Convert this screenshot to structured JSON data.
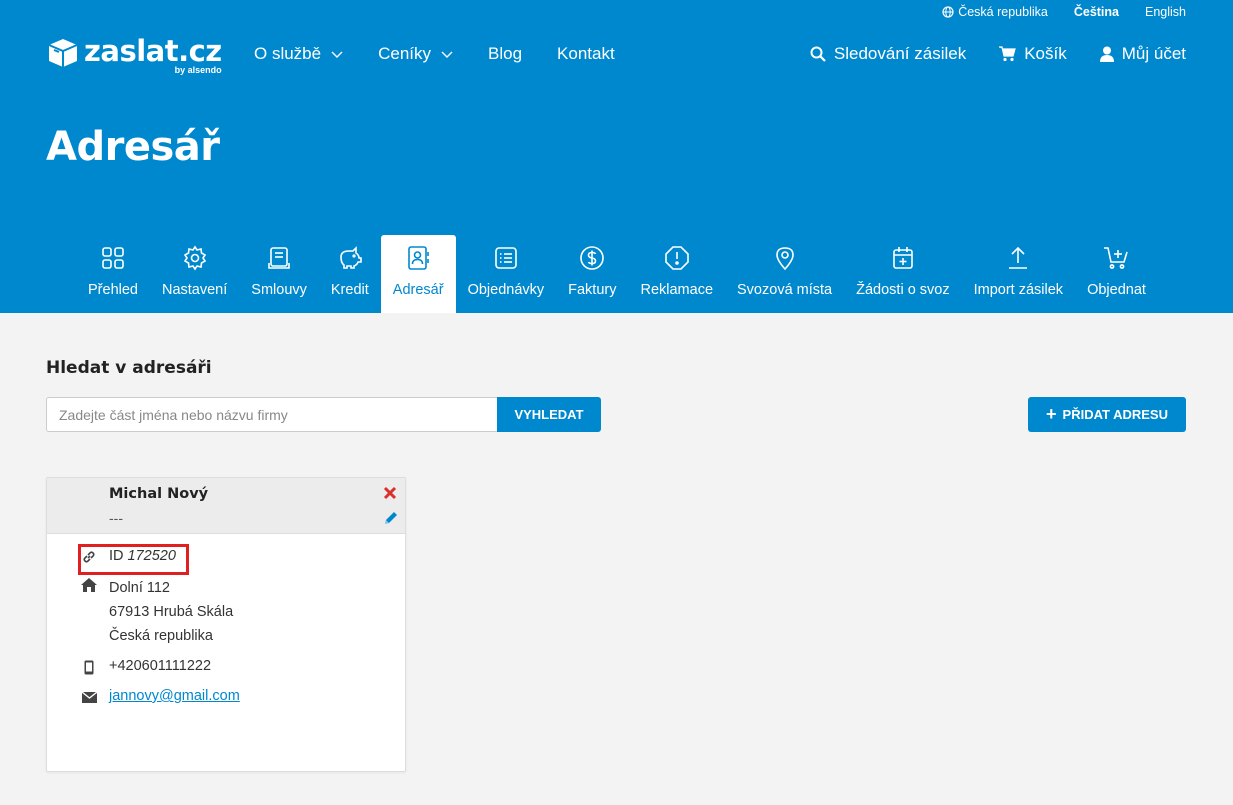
{
  "topbar": {
    "country": "Česká republika",
    "lang_active": "Čeština",
    "lang_other": "English"
  },
  "logo": {
    "name": "zaslat.cz",
    "by": "by alsendo"
  },
  "mainnav": {
    "about": "O službě",
    "prices": "Ceníky",
    "blog": "Blog",
    "contact": "Kontakt"
  },
  "rightnav": {
    "tracking": "Sledování zásilek",
    "cart": "Košík",
    "account": "Můj účet"
  },
  "page_title": "Adresář",
  "tabs": [
    {
      "label": "Přehled",
      "icon": "grid-icon"
    },
    {
      "label": "Nastavení",
      "icon": "gear-icon"
    },
    {
      "label": "Smlouvy",
      "icon": "contract-icon"
    },
    {
      "label": "Kredit",
      "icon": "piggy-bank-icon"
    },
    {
      "label": "Adresář",
      "icon": "address-book-icon"
    },
    {
      "label": "Objednávky",
      "icon": "list-icon"
    },
    {
      "label": "Faktury",
      "icon": "dollar-icon"
    },
    {
      "label": "Reklamace",
      "icon": "alert-icon"
    },
    {
      "label": "Svozová místa",
      "icon": "pin-icon"
    },
    {
      "label": "Žádosti o svoz",
      "icon": "calendar-plus-icon"
    },
    {
      "label": "Import zásilek",
      "icon": "upload-icon"
    },
    {
      "label": "Objednat",
      "icon": "cart-plus-icon"
    }
  ],
  "search": {
    "title": "Hledat v adresáři",
    "placeholder": "Zadejte část jména nebo názvu firmy",
    "button": "VYHLEDAT",
    "add_button": "PŘIDAT ADRESU"
  },
  "card": {
    "name": "Michal Nový",
    "company": "---",
    "id_label": "ID",
    "id_value": "172520",
    "street": "Dolní 112",
    "city": "67913 Hrubá Skála",
    "country": "Česká republika",
    "phone": "+420601111222",
    "email": "jannovy@gmail.com"
  },
  "colors": {
    "brand": "#0088cf",
    "highlight": "#e02020",
    "delete": "#d9302c"
  }
}
